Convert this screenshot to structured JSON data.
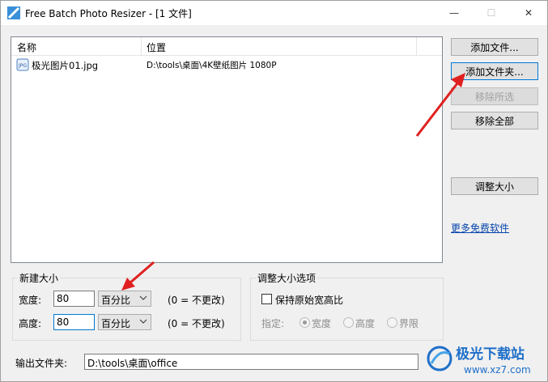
{
  "window": {
    "title": "Free Batch Photo Resizer - [1 文件]",
    "min_glyph": "—",
    "max_glyph": "☐",
    "close_glyph": "✕"
  },
  "list": {
    "columns": [
      "名称",
      "位置"
    ],
    "rows": [
      {
        "name": "极光图片01.jpg",
        "path": "D:\\tools\\桌面\\4K壁纸图片 1080P",
        "icon": "jpg-file-icon"
      }
    ]
  },
  "buttons": {
    "add_file": "添加文件...",
    "add_folder": "添加文件夹...",
    "remove_selected": "移除所选",
    "remove_all": "移除全部",
    "resize": "调整大小"
  },
  "more_link": "更多免费软件",
  "new_size": {
    "group_label": "新建大小",
    "width_label": "宽度:",
    "width_value": "80",
    "width_unit": "百分比",
    "width_hint": "(0 = 不更改)",
    "height_label": "高度:",
    "height_value": "80",
    "height_unit": "百分比",
    "height_hint": "(0 = 不更改)"
  },
  "resize_options": {
    "group_label": "调整大小选项",
    "keep_ratio_label": "保持原始宽高比",
    "keep_ratio_checked": false,
    "specify_label": "指定:",
    "radio_width": "宽度",
    "radio_height": "高度",
    "radio_bound": "界限",
    "selected": "宽度"
  },
  "output": {
    "label": "输出文件夹:",
    "value": "D:\\tools\\桌面\\office"
  },
  "watermark": {
    "text": "极光下载站",
    "url": "www.xz7.com"
  },
  "colors": {
    "annotation_arrow": "#e02020",
    "link": "#0645ad"
  }
}
